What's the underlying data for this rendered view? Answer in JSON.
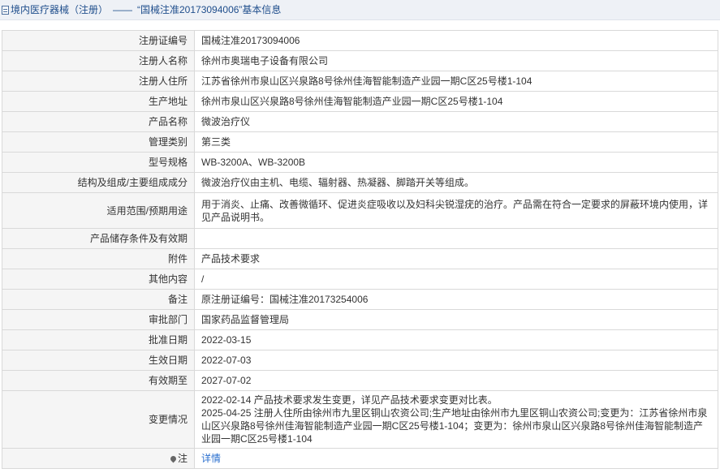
{
  "header": {
    "category": "境内医疗器械（注册）",
    "separator": "——",
    "title": "“国械注准20173094006”基本信息"
  },
  "rows": [
    {
      "label": "注册证编号",
      "value": "国械注准20173094006"
    },
    {
      "label": "注册人名称",
      "value": "徐州市奥瑞电子设备有限公司"
    },
    {
      "label": "注册人住所",
      "value": "江苏省徐州市泉山区兴泉路8号徐州佳海智能制造产业园一期C区25号楼1-104"
    },
    {
      "label": "生产地址",
      "value": "徐州市泉山区兴泉路8号徐州佳海智能制造产业园一期C区25号楼1-104"
    },
    {
      "label": "产品名称",
      "value": "微波治疗仪"
    },
    {
      "label": "管理类别",
      "value": "第三类"
    },
    {
      "label": "型号规格",
      "value": "WB-3200A、WB-3200B"
    },
    {
      "label": "结构及组成/主要组成成分",
      "value": "微波治疗仪由主机、电缆、辐射器、热凝器、脚踏开关等组成。"
    },
    {
      "label": "适用范围/预期用途",
      "value": "用于消炎、止痛、改善微循环、促进炎症吸收以及妇科尖锐湿疣的治疗。产品需在符合一定要求的屏蔽环境内使用，详见产品说明书。"
    },
    {
      "label": "产品储存条件及有效期",
      "value": ""
    },
    {
      "label": "附件",
      "value": "产品技术要求"
    },
    {
      "label": "其他内容",
      "value": "/"
    },
    {
      "label": "备注",
      "value": "原注册证编号：国械注准20173254006"
    },
    {
      "label": "审批部门",
      "value": "国家药品监督管理局"
    },
    {
      "label": "批准日期",
      "value": "2022-03-15"
    },
    {
      "label": "生效日期",
      "value": "2022-07-03"
    },
    {
      "label": "有效期至",
      "value": "2027-07-02"
    }
  ],
  "changes": {
    "label": "变更情况",
    "line1": "2022-02-14 产品技术要求发生变更，详见产品技术要求变更对比表。",
    "line2": "2025-04-25 注册人住所由徐州市九里区铜山农资公司;生产地址由徐州市九里区铜山农资公司;变更为：江苏省徐州市泉山区兴泉路8号徐州佳海智能制造产业园一期C区25号楼1-104；变更为：徐州市泉山区兴泉路8号徐州佳海智能制造产业园一期C区25号楼1-104"
  },
  "note": {
    "label": "注",
    "link": "详情"
  },
  "icons": {
    "header": "document-icon",
    "note": "map-pin-icon"
  }
}
